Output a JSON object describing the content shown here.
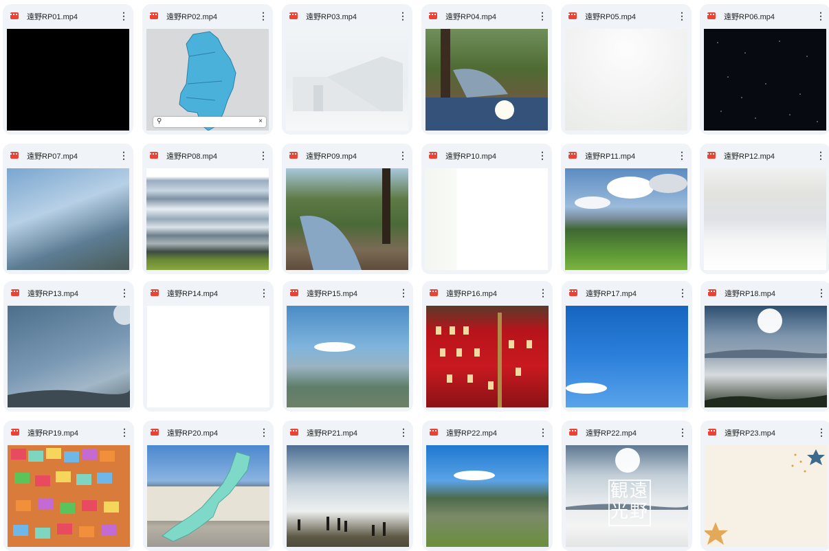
{
  "files": [
    {
      "name": "遠野RP01.mp4",
      "thumb": "black-frame"
    },
    {
      "name": "遠野RP02.mp4",
      "thumb": "tohoku-map"
    },
    {
      "name": "遠野RP03.mp4",
      "thumb": "faded-building"
    },
    {
      "name": "遠野RP04.mp4",
      "thumb": "stream-and-sky"
    },
    {
      "name": "遠野RP05.mp4",
      "thumb": "white-fog"
    },
    {
      "name": "遠野RP06.mp4",
      "thumb": "starfield"
    },
    {
      "name": "遠野RP07.mp4",
      "thumb": "tree-reflection"
    },
    {
      "name": "遠野RP08.mp4",
      "thumb": "motion-blur"
    },
    {
      "name": "遠野RP09.mp4",
      "thumb": "stream-trees"
    },
    {
      "name": "遠野RP10.mp4",
      "thumb": "white-frame"
    },
    {
      "name": "遠野RP11.mp4",
      "thumb": "mountain-clouds"
    },
    {
      "name": "遠野RP12.mp4",
      "thumb": "hazy-light"
    },
    {
      "name": "遠野RP13.mp4",
      "thumb": "sky-sun-flare"
    },
    {
      "name": "遠野RP14.mp4",
      "thumb": "blank-white"
    },
    {
      "name": "遠野RP15.mp4",
      "thumb": "watercolor-valley"
    },
    {
      "name": "遠野RP16.mp4",
      "thumb": "hina-dolls"
    },
    {
      "name": "遠野RP17.mp4",
      "thumb": "blue-sky"
    },
    {
      "name": "遠野RP18.mp4",
      "thumb": "sea-of-clouds"
    },
    {
      "name": "遠野RP19.mp4",
      "thumb": "ema-plaques"
    },
    {
      "name": "遠野RP20.mp4",
      "thumb": "station-japan-map"
    },
    {
      "name": "遠野RP21.mp4",
      "thumb": "people-cloud-sea"
    },
    {
      "name": "遠野RP22.mp4",
      "thumb": "valley-town"
    },
    {
      "name": "遠野RP22.mp4",
      "thumb": "cloud-sea-logo"
    },
    {
      "name": "遠野RP23.mp4",
      "thumb": "cream-stars"
    }
  ],
  "overlay": {
    "map_search_clear": "×",
    "logo_text_line1": "観遠",
    "logo_text_line2": "光野"
  },
  "icons": {
    "file_type": "video-file-icon",
    "menu": "more-vert-icon"
  },
  "colors": {
    "card_bg": "#f0f4f9",
    "video_icon": "#ea4335"
  }
}
